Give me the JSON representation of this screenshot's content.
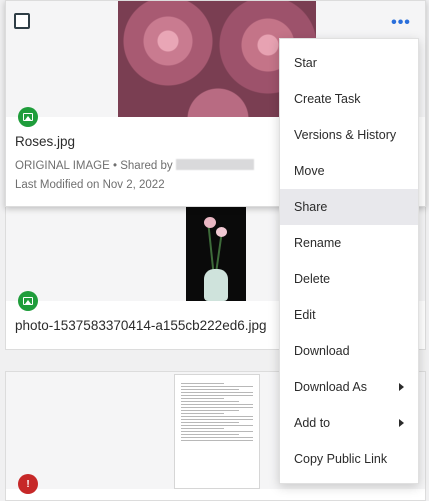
{
  "cards": [
    {
      "file_name": "Roses.jpg",
      "type_label": "ORIGINAL IMAGE",
      "shared_prefix": "Shared by",
      "last_modified": "Last Modified on Nov 2, 2022",
      "type_icon": "image-icon"
    },
    {
      "file_name": "photo-1537583370414-a155cb222ed6.jpg",
      "type_icon": "image-icon"
    },
    {
      "type_icon": "error-icon",
      "type_glyph": "!"
    }
  ],
  "more_button": {
    "glyph": "•••"
  },
  "context_menu": {
    "items": [
      {
        "label": "Star"
      },
      {
        "label": "Create Task"
      },
      {
        "label": "Versions & History"
      },
      {
        "label": "Move"
      },
      {
        "label": "Share"
      },
      {
        "label": "Rename"
      },
      {
        "label": "Delete"
      },
      {
        "label": "Edit"
      },
      {
        "label": "Download"
      },
      {
        "label": "Download As"
      },
      {
        "label": "Add to"
      },
      {
        "label": "Copy Public Link"
      }
    ],
    "active_label": "Share"
  },
  "colors": {
    "accent": "#2a6fdb",
    "image_badge": "#1f9d3b",
    "error_badge": "#c62828",
    "menu_highlight": "#e8e8ec"
  }
}
